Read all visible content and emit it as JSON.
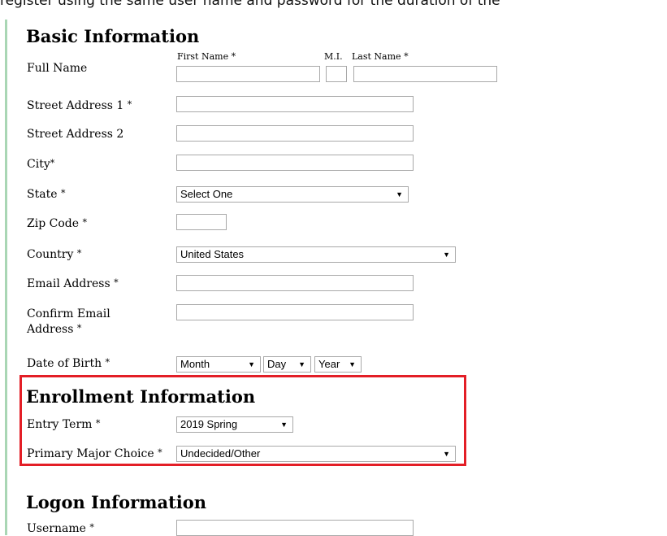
{
  "caption": "register using the same user name and password for the duration of the",
  "basic": {
    "title": "Basic Information",
    "full_name": "Full Name",
    "first_name": "First Name",
    "mi": "M.I.",
    "last_name": "Last Name",
    "street1": "Street Address 1",
    "street2": "Street Address 2",
    "city": "City",
    "state": "State",
    "state_value": "Select One",
    "zip": "Zip Code",
    "country": "Country",
    "country_value": "United States",
    "email": "Email Address",
    "confirm_email": "Confirm Email Address",
    "dob": "Date of Birth",
    "month": "Month",
    "day": "Day",
    "year": "Year"
  },
  "enrollment": {
    "title": "Enrollment Information",
    "entry_term": "Entry Term",
    "entry_term_value": "2019 Spring",
    "major": "Primary Major Choice",
    "major_value": "Undecided/Other"
  },
  "logon": {
    "title": "Logon Information",
    "username": "Username"
  },
  "required_marker": "*",
  "arrow_glyph": "▼",
  "highlight_color": "#e31e26"
}
